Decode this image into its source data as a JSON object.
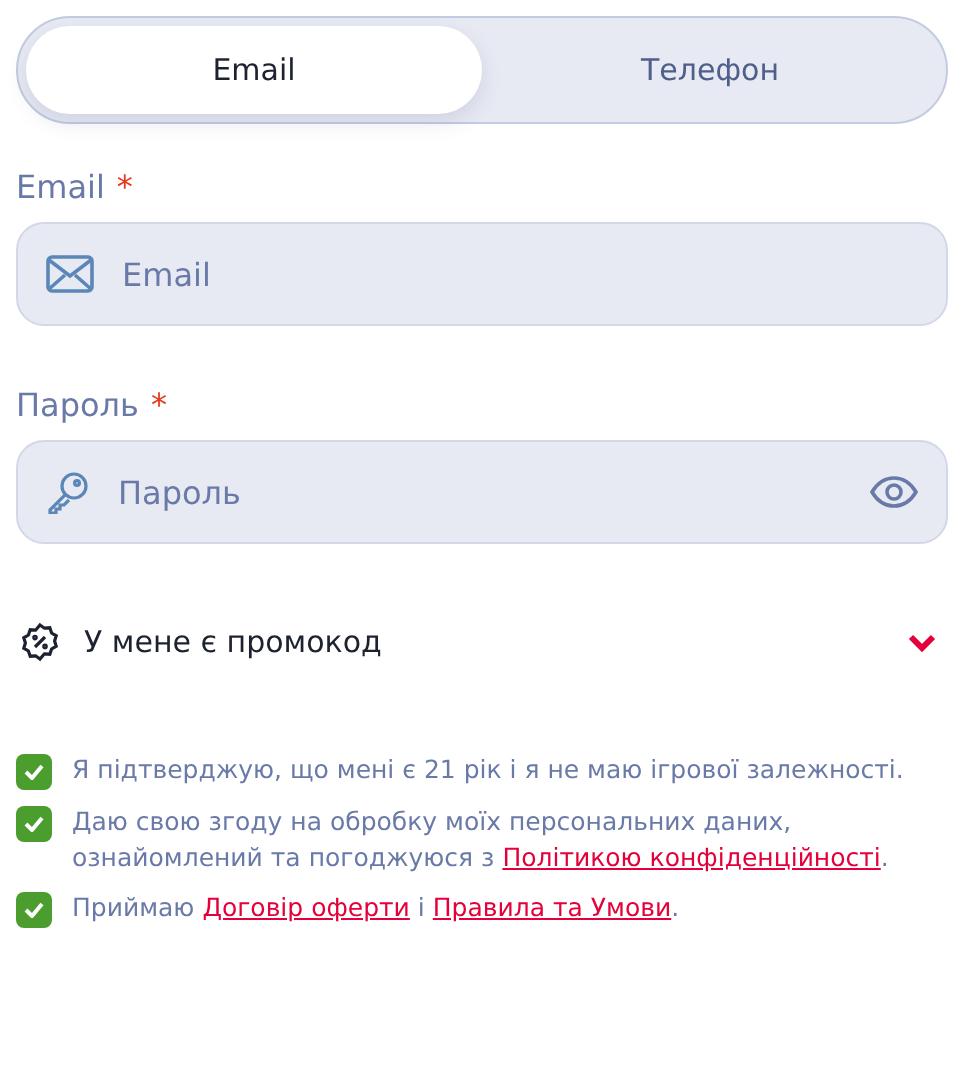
{
  "tabs": [
    {
      "label": "Email",
      "selected": true
    },
    {
      "label": "Телефон",
      "selected": false
    }
  ],
  "fields": [
    {
      "kind": "email",
      "label": "Email",
      "required_mark": "*",
      "placeholder": "Email"
    },
    {
      "kind": "password",
      "label": "Пароль",
      "required_mark": "*",
      "placeholder": "Пароль"
    }
  ],
  "promo": {
    "label": "У мене є  промокод",
    "expanded": false
  },
  "agreements": [
    {
      "checked": true,
      "segments": [
        {
          "kind": "text",
          "text": "Я підтверджую, що мені є 21 рік і я не маю ігрової залежності."
        }
      ]
    },
    {
      "checked": true,
      "segments": [
        {
          "kind": "text",
          "text": "Даю свою згоду на обробку моїх персональних даних, ознайомлений та погоджуюся з"
        },
        {
          "kind": "link",
          "text": "Політикою конфіденційності"
        },
        {
          "kind": "text",
          "text": "."
        }
      ]
    },
    {
      "checked": true,
      "segments": [
        {
          "kind": "text",
          "text": "Приймаю"
        },
        {
          "kind": "link",
          "text": "Договір оферти"
        },
        {
          "kind": "text",
          "text": "і"
        },
        {
          "kind": "link",
          "text": "Правила та Умови"
        },
        {
          "kind": "text",
          "text": "."
        }
      ]
    }
  ]
}
